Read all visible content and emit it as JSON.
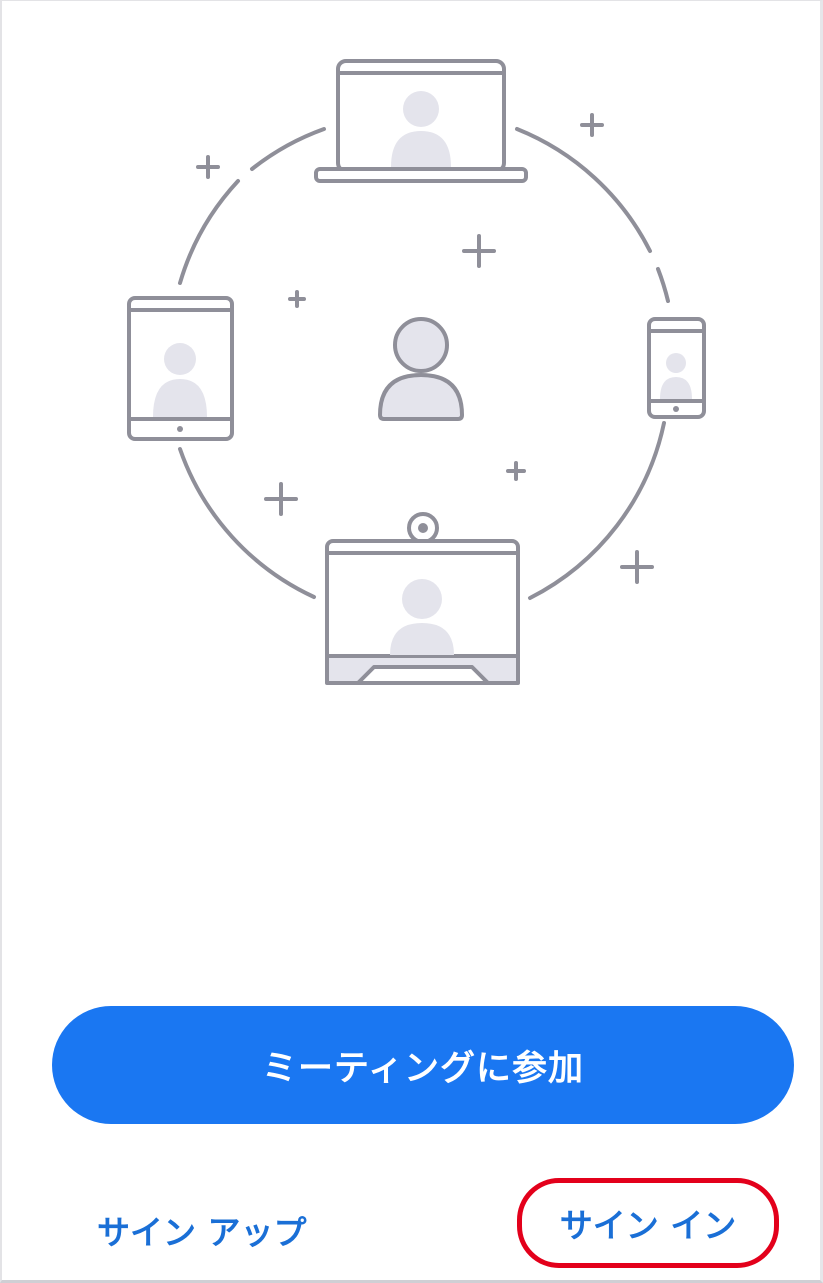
{
  "colors": {
    "accent": "#1a77f2",
    "link": "#1a6fd6",
    "highlight": "#e3001b",
    "illustration_stroke": "#8f8f99",
    "illustration_fill": "#e4e4ec"
  },
  "illustration": {
    "devices": [
      "laptop-icon",
      "tablet-icon",
      "phone-icon",
      "video-room-system-icon"
    ],
    "center": "user-icon"
  },
  "actions": {
    "join_meeting_label": "ミーティングに参加",
    "sign_up_label": "サイン アップ",
    "sign_in_label": "サイン イン"
  }
}
